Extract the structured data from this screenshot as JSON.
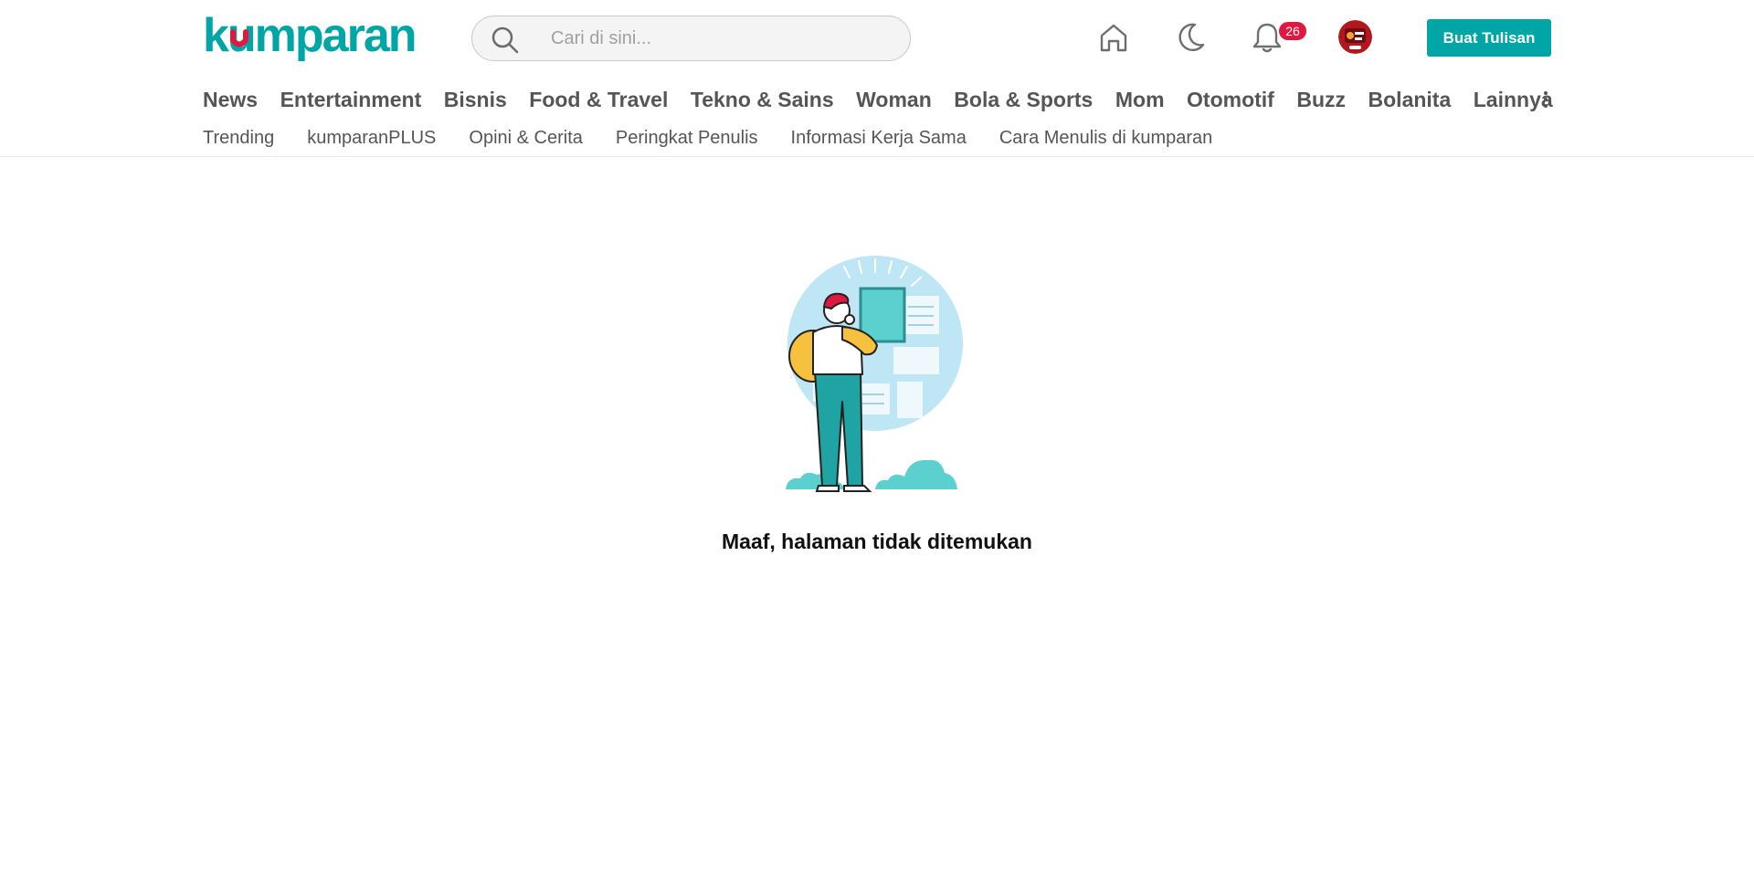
{
  "brand": {
    "name": "kumparan",
    "accent_color": "#00a5a6",
    "logo_dot_color": "#e0173f"
  },
  "search": {
    "placeholder": "Cari di sini...",
    "value": ""
  },
  "header_icons": {
    "home": "home-icon",
    "theme": "moon-icon",
    "notifications": "bell-icon"
  },
  "notifications": {
    "count": "26"
  },
  "write_button": {
    "label": "Buat Tulisan"
  },
  "nav_main": {
    "items": [
      {
        "label": "News"
      },
      {
        "label": "Entertainment"
      },
      {
        "label": "Bisnis"
      },
      {
        "label": "Food & Travel"
      },
      {
        "label": "Tekno & Sains"
      },
      {
        "label": "Woman"
      },
      {
        "label": "Bola & Sports"
      },
      {
        "label": "Mom"
      },
      {
        "label": "Otomotif"
      },
      {
        "label": "Buzz"
      },
      {
        "label": "Bolanita"
      },
      {
        "label": "Lainnya"
      }
    ]
  },
  "nav_sub": {
    "items": [
      {
        "label": "Trending"
      },
      {
        "label": "kumparanPLUS"
      },
      {
        "label": "Opini & Cerita"
      },
      {
        "label": "Peringkat Penulis"
      },
      {
        "label": "Informasi Kerja Sama"
      },
      {
        "label": "Cara Menulis di kumparan"
      }
    ]
  },
  "not_found": {
    "message": "Maaf, halaman tidak ditemukan"
  }
}
